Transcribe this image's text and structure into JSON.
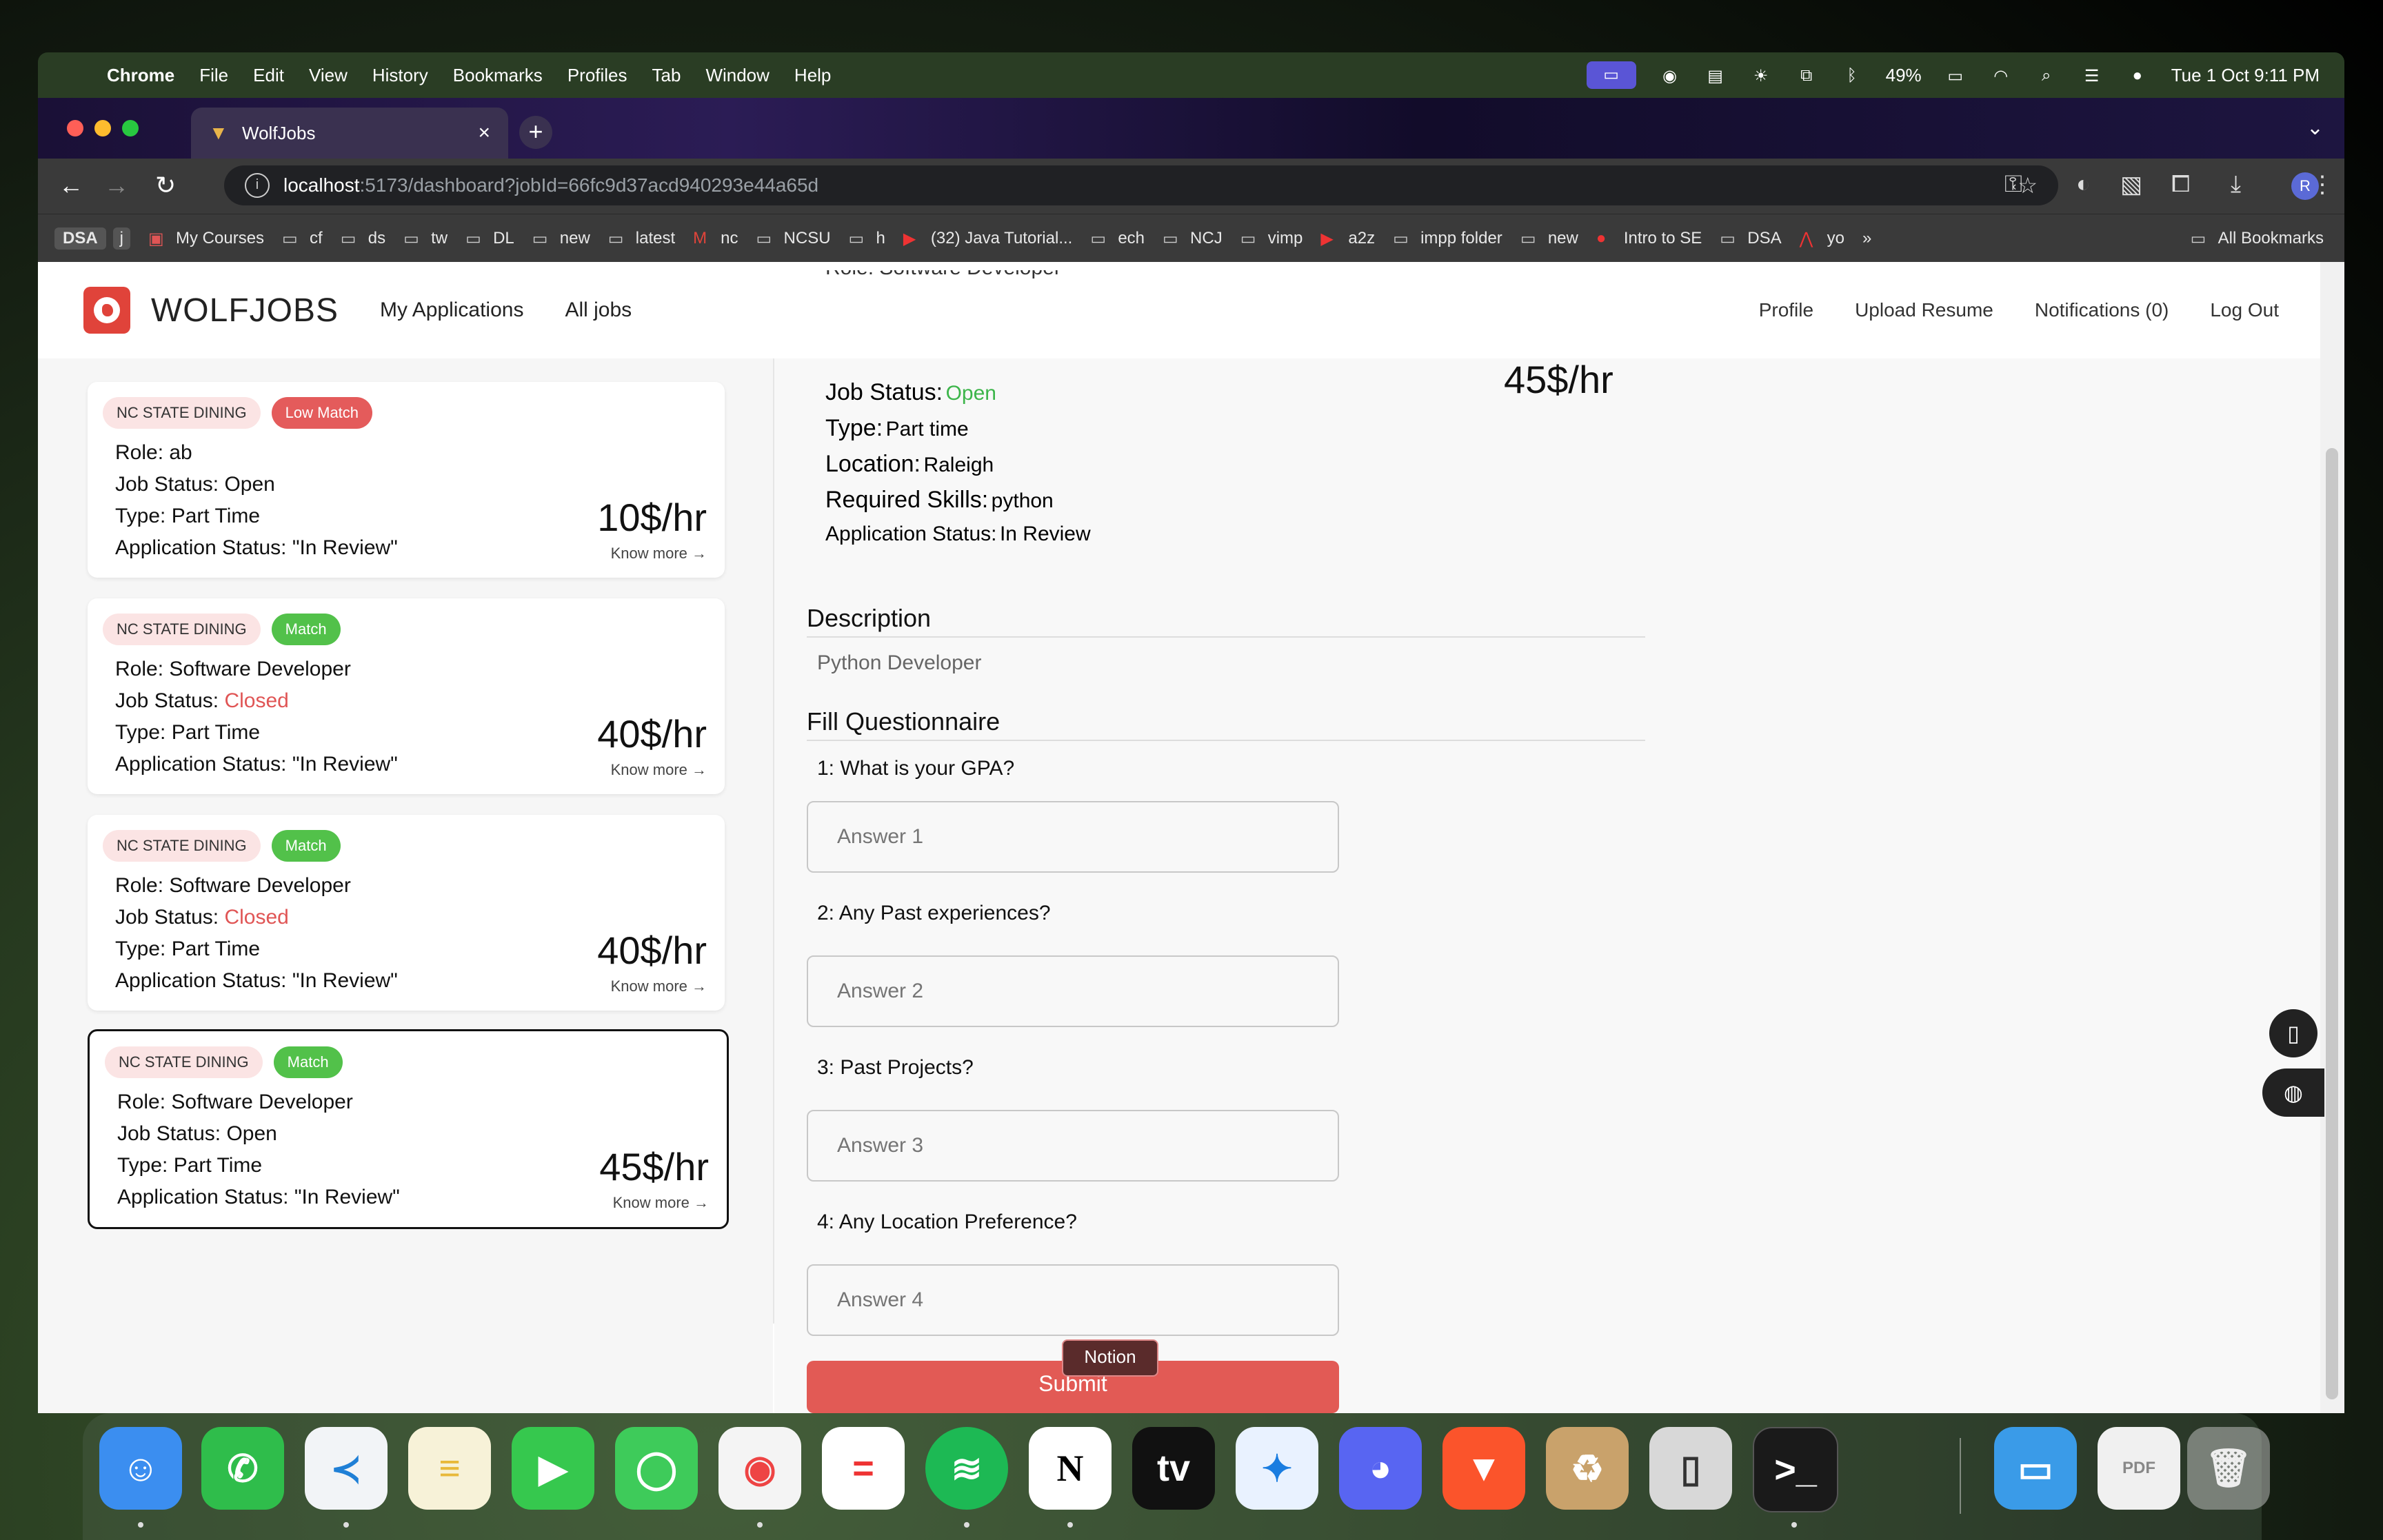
{
  "menubar": {
    "app": "Chrome",
    "items": [
      "File",
      "Edit",
      "View",
      "History",
      "Bookmarks",
      "Profiles",
      "Tab",
      "Window",
      "Help"
    ],
    "battery": "49%",
    "datetime": "Tue 1 Oct  9:11 PM"
  },
  "browser": {
    "tab_title": "WolfJobs",
    "url_host": "localhost",
    "url_path": ":5173/dashboard?jobId=66fc9d37acd940293e44a65d",
    "profile_initial": "R",
    "bookmarks": [
      {
        "label": "My Courses",
        "icon": "course-icon"
      },
      {
        "label": "cf",
        "icon": "folder-icon"
      },
      {
        "label": "ds",
        "icon": "folder-icon"
      },
      {
        "label": "tw",
        "icon": "folder-icon"
      },
      {
        "label": "DL",
        "icon": "folder-icon"
      },
      {
        "label": "new",
        "icon": "folder-icon"
      },
      {
        "label": "latest",
        "icon": "folder-icon"
      },
      {
        "label": "nc",
        "icon": "gmail-icon"
      },
      {
        "label": "NCSU",
        "icon": "folder-icon"
      },
      {
        "label": "h",
        "icon": "folder-icon"
      },
      {
        "label": "(32) Java Tutorial...",
        "icon": "youtube-icon"
      },
      {
        "label": "ech",
        "icon": "folder-icon"
      },
      {
        "label": "NCJ",
        "icon": "folder-icon"
      },
      {
        "label": "vimp",
        "icon": "folder-icon"
      },
      {
        "label": "a2z",
        "icon": "youtube-icon"
      },
      {
        "label": "impp folder",
        "icon": "folder-icon"
      },
      {
        "label": "new",
        "icon": "folder-icon"
      },
      {
        "label": "Intro to SE",
        "icon": "se-icon"
      },
      {
        "label": "DSA",
        "icon": "folder-icon"
      },
      {
        "label": "yo",
        "icon": "acrobat-icon"
      }
    ],
    "bookmark_chip_1": "DSA",
    "bookmark_chip_2": "j",
    "overflow": "»",
    "all_bookmarks": "All Bookmarks"
  },
  "nav": {
    "brand": "WOLFJOBS",
    "my_applications": "My Applications",
    "all_jobs": "All jobs",
    "profile": "Profile",
    "upload_resume": "Upload Resume",
    "notifications": "Notifications (0)",
    "logout": "Log Out"
  },
  "applications": [
    {
      "company": "NC STATE DINING",
      "match": "Low Match",
      "match_type": "low",
      "role": "Role: ab",
      "status_label": "Job Status: ",
      "status": "Open",
      "type": "Type: Part Time",
      "app_status": "Application Status: \"In Review\"",
      "pay": "10$/hr",
      "more": "Know more →"
    },
    {
      "company": "NC STATE DINING",
      "match": "Match",
      "match_type": "match",
      "role": "Role: Software Developer",
      "status_label": "Job Status: ",
      "status": "Closed",
      "type": "Type: Part Time",
      "app_status": "Application Status: \"In Review\"",
      "pay": "40$/hr",
      "more": "Know more →"
    },
    {
      "company": "NC STATE DINING",
      "match": "Match",
      "match_type": "match",
      "role": "Role: Software Developer",
      "status_label": "Job Status: ",
      "status": "Closed",
      "type": "Type: Part Time",
      "app_status": "Application Status: \"In Review\"",
      "pay": "40$/hr",
      "more": "Know more →"
    },
    {
      "company": "NC STATE DINING",
      "match": "Match",
      "match_type": "match",
      "role": "Role: Software Developer",
      "status_label": "Job Status: ",
      "status": "Open",
      "type": "Type: Part Time",
      "app_status": "Application Status: \"In Review\"",
      "pay": "45$/hr",
      "more": "Know more →"
    }
  ],
  "detail": {
    "role_partial": "Role: Software Developer",
    "job_status_label": "Job Status:",
    "job_status": "Open",
    "type_label": "Type:",
    "type": "Part time",
    "location_label": "Location:",
    "location": "Raleigh",
    "skills_label": "Required Skills:",
    "skills": "python",
    "app_status_label": "Application Status:",
    "app_status": "In Review",
    "pay": "45$/hr",
    "description_title": "Description",
    "description": "Python Developer",
    "questionnaire_title": "Fill Questionnaire",
    "questions": [
      {
        "label": "1: What is your GPA?",
        "placeholder": "Answer 1"
      },
      {
        "label": "2: Any Past experiences?",
        "placeholder": "Answer 2"
      },
      {
        "label": "3: Past Projects?",
        "placeholder": "Answer 3"
      },
      {
        "label": "4: Any Location Preference?",
        "placeholder": "Answer 4"
      }
    ],
    "submit": "Submit",
    "tooltip": "Notion"
  },
  "colors": {
    "brand_red": "#e0433a",
    "match_green": "#52c14a",
    "low_match_red": "#e45b5b",
    "closed_red": "#e05555",
    "open_green": "#3cb54a",
    "submit_red": "#e25a55"
  },
  "dock": [
    "finder-icon",
    "whatsapp-icon",
    "vscode-icon",
    "notes-icon",
    "facetime-icon",
    "messages-icon",
    "chrome-icon",
    "todo-icon",
    "spotify-icon",
    "notion-icon",
    "appletv-icon",
    "safari-icon",
    "discord-icon",
    "brave-icon",
    "archive-utility-icon",
    "iphone-mirroring-icon",
    "terminal-icon",
    "folder-icon",
    "pdf-icon",
    "trash-icon"
  ]
}
